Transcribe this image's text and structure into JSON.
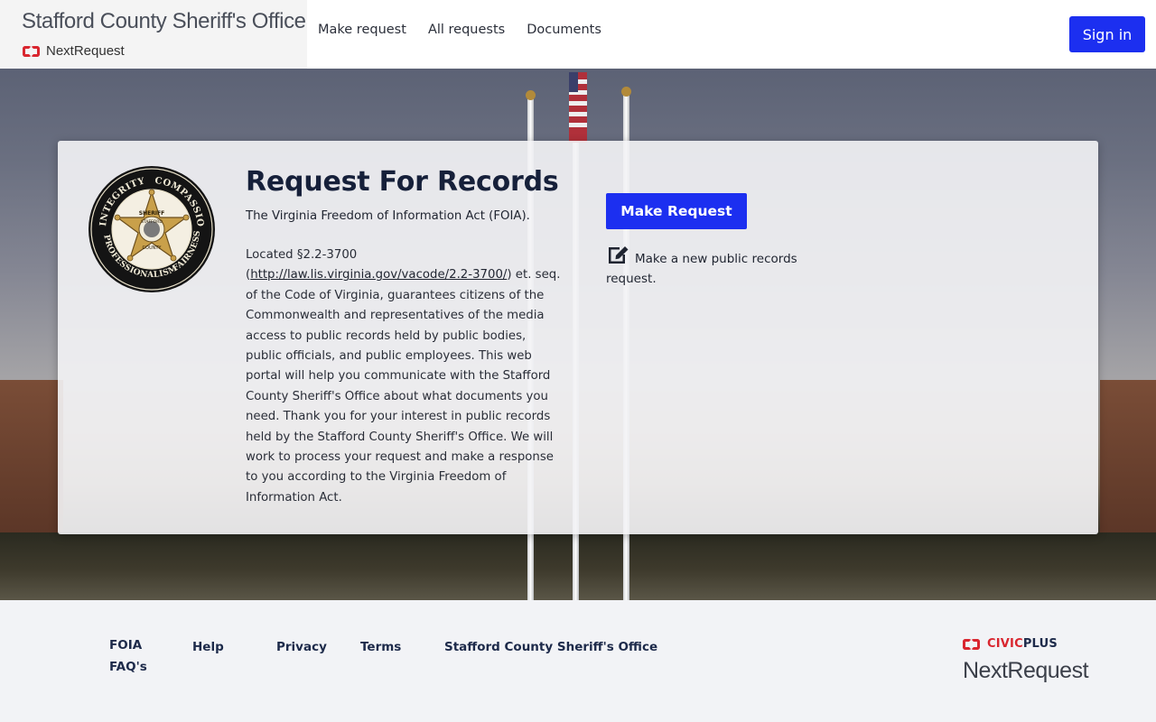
{
  "header": {
    "org_name": "Stafford County Sheriff's Office",
    "product_name": "NextRequest",
    "nav": {
      "make_request": "Make request",
      "all_requests": "All requests",
      "documents": "Documents"
    },
    "sign_in": "Sign in"
  },
  "card": {
    "title": "Request For Records",
    "subtitle": "The Virginia Freedom of Information Act (FOIA).",
    "body_prefix": "Located §2.2-3700 (",
    "body_link": "http://law.lis.virginia.gov/vacode/2.2-3700/",
    "body_suffix": ") et. seq. of the Code of Virginia, guarantees citizens of the Commonwealth and representatives of the media access to public records held by public bodies, public officials, and public employees. This web portal will help you communicate with the Stafford County Sheriff's Office about what documents you need. Thank you for your interest in public records held by the Stafford County Sheriff's Office. We will work to process your request and make a response to you according to the Virginia Freedom of Information Act.",
    "make_request_button": "Make Request",
    "make_request_desc": "Make a new public records request.",
    "seal": {
      "top_left": "INTEGRITY",
      "top_right": "COMPASSION",
      "bottom_left": "PROFESSIONALISM",
      "bottom_right": "FAIRNESS",
      "center_top": "SHERIFF",
      "center_mid": "STAFFORD",
      "center_bottom": "COUNTY"
    }
  },
  "footer": {
    "links": {
      "foia_faqs": "FOIA FAQ's",
      "help": "Help",
      "privacy": "Privacy",
      "terms": "Terms",
      "org": "Stafford County Sheriff's Office"
    },
    "civic_red": "CIVIC",
    "civic_dark": "PLUS",
    "product": "NextRequest"
  },
  "colors": {
    "primary_button": "#1c2ff0",
    "brand_red": "#d9262f",
    "title_navy": "#16203a"
  }
}
